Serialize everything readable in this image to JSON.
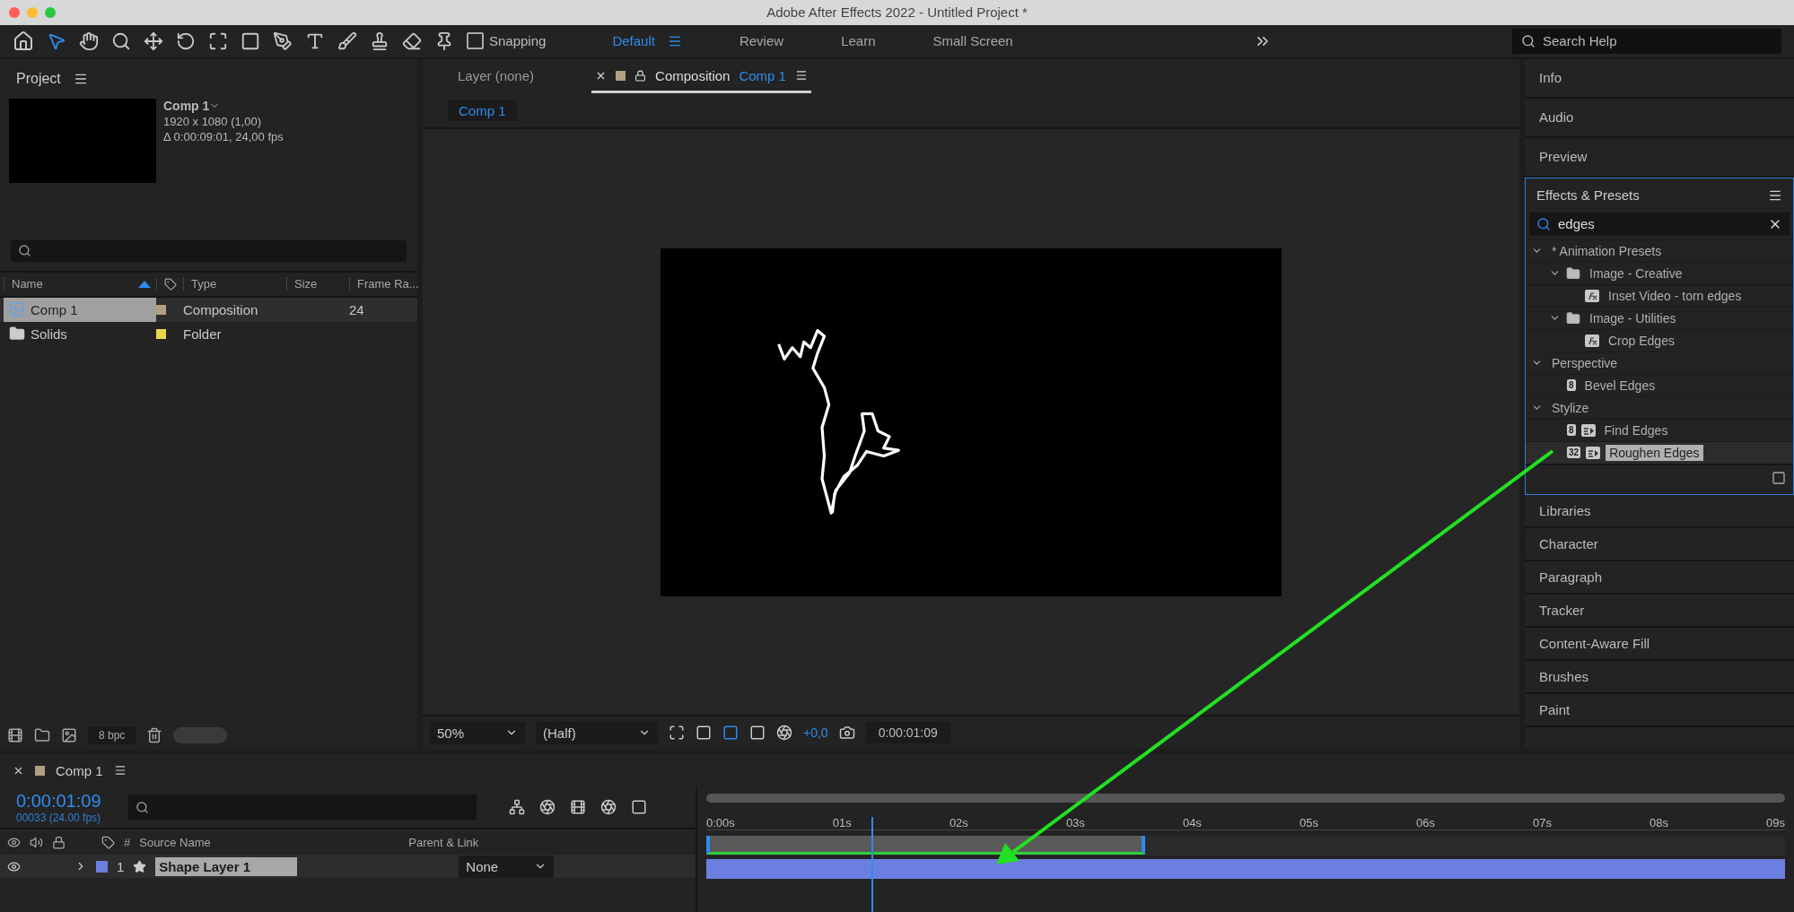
{
  "window": {
    "title": "Adobe After Effects 2022 - Untitled Project *"
  },
  "toolbar": {
    "snapping": {
      "label": "Snapping",
      "checked": false
    },
    "workspaces": [
      {
        "label": "Default",
        "selected": true
      },
      {
        "label": "Review",
        "selected": false
      },
      {
        "label": "Learn",
        "selected": false
      },
      {
        "label": "Small Screen",
        "selected": false
      }
    ],
    "search": {
      "placeholder": "Search Help"
    }
  },
  "project": {
    "title": "Project",
    "comp": {
      "name": "Comp 1",
      "resolution": "1920 x 1080 (1,00)",
      "duration": "Δ 0:00:09:01, 24,00 fps"
    },
    "columns": [
      "Name",
      "Type",
      "Size",
      "Frame Ra..."
    ],
    "items": [
      {
        "name": "Comp 1",
        "kind": "composition",
        "type": "Composition",
        "frame_rate": "24",
        "color": "#b09f80",
        "selected": true
      },
      {
        "name": "Solids",
        "kind": "folder",
        "type": "Folder",
        "color": "#e8d84a",
        "selected": false
      }
    ],
    "bit_depth": "8 bpc"
  },
  "viewer": {
    "tabs": [
      {
        "label": "Layer (none)",
        "selected": false
      },
      {
        "label": "Composition",
        "comp": "Comp 1",
        "selected": true
      }
    ],
    "breadcrumb": "Comp 1",
    "zoom": "50%",
    "resolution": "(Half)",
    "exposure": "+0,0",
    "timecode": "0:00:01:09"
  },
  "panels_top": [
    "Info",
    "Audio",
    "Preview"
  ],
  "effects": {
    "title": "Effects & Presets",
    "search": "edges",
    "tree": [
      {
        "label": "* Animation Presets",
        "expanded": true,
        "children": [
          {
            "label": "Image - Creative",
            "kind": "folder",
            "expanded": true,
            "children": [
              {
                "label": "Inset Video - torn edges",
                "kind": "preset",
                "selected": false
              }
            ]
          },
          {
            "label": "Image - Utilities",
            "kind": "folder",
            "expanded": true,
            "children": [
              {
                "label": "Crop Edges",
                "kind": "preset",
                "selected": false
              }
            ]
          }
        ]
      },
      {
        "label": "Perspective",
        "expanded": true,
        "children": [
          {
            "label": "Bevel Edges",
            "kind": "effect",
            "bits": "8",
            "selected": false
          }
        ]
      },
      {
        "label": "Stylize",
        "expanded": true,
        "children": [
          {
            "label": "Find Edges",
            "kind": "effect",
            "bits": "8",
            "animatable": true,
            "selected": false
          },
          {
            "label": "Roughen Edges",
            "kind": "effect",
            "bits": "32",
            "animatable": true,
            "selected": true
          }
        ]
      }
    ]
  },
  "panels_bottom": [
    "Libraries",
    "Character",
    "Paragraph",
    "Tracker",
    "Content-Aware Fill",
    "Brushes",
    "Paint"
  ],
  "timeline": {
    "tab": "Comp 1",
    "timecode": "0:00:01:09",
    "frame_info": "00033 (24.00 fps)",
    "columns": [
      "#",
      "Source Name",
      "Parent & Link"
    ],
    "layers": [
      {
        "number": "1",
        "name": "Shape Layer 1",
        "color": "#6b7fe0",
        "parent": "None",
        "visible": true,
        "selected": true
      }
    ],
    "ruler": [
      "0:00s",
      "01s",
      "02s",
      "03s",
      "04s",
      "05s",
      "06s",
      "07s",
      "08s",
      "09s"
    ],
    "playhead": {
      "level": 0.153
    },
    "work_area": {
      "level": 0.4
    }
  }
}
